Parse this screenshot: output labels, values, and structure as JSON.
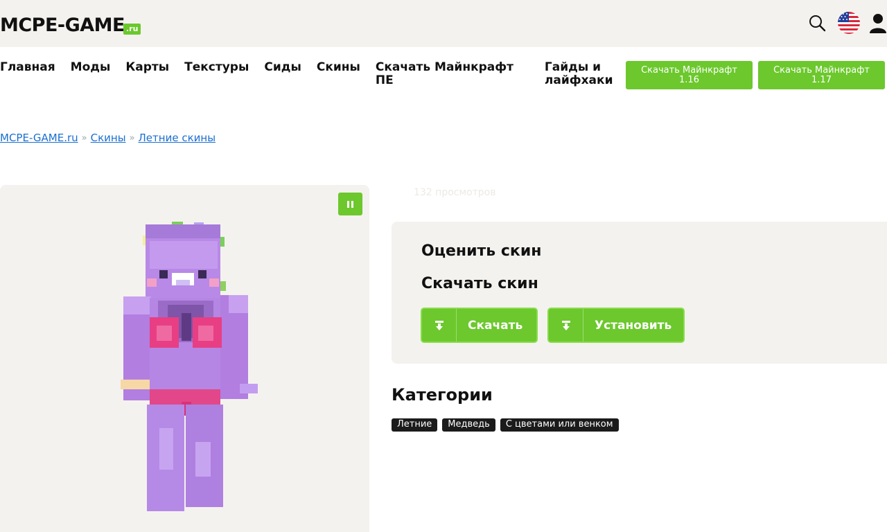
{
  "header": {
    "logo_text": "MCPE-GAME",
    "logo_suffix": ".ru"
  },
  "nav": {
    "items": [
      "Главная",
      "Моды",
      "Карты",
      "Текстуры",
      "Сиды",
      "Скины",
      "Скачать Майнкрафт ПЕ",
      "Гайды и лайфхаки"
    ]
  },
  "download_buttons": [
    {
      "line1": "Скачать Майнкрафт",
      "line2": "1.16"
    },
    {
      "line1": "Скачать Майнкрафт",
      "line2": "1.17"
    }
  ],
  "breadcrumbs": {
    "items": [
      "MCPE-GAME.ru",
      "Скины",
      "Летние скины"
    ],
    "separator": "»"
  },
  "preview": {
    "views": "132 просмотров"
  },
  "rating": {
    "rate_title": "Оценить скин",
    "download_title": "Скачать скин",
    "download_label": "Скачать",
    "install_label": "Установить"
  },
  "categories": {
    "title": "Категории",
    "tags": [
      "Летние",
      "Медведь",
      "С цветами или венком"
    ]
  },
  "colors": {
    "accent": "#6cc82d",
    "link": "#1a6fd1",
    "panel": "#f4f2ee"
  }
}
